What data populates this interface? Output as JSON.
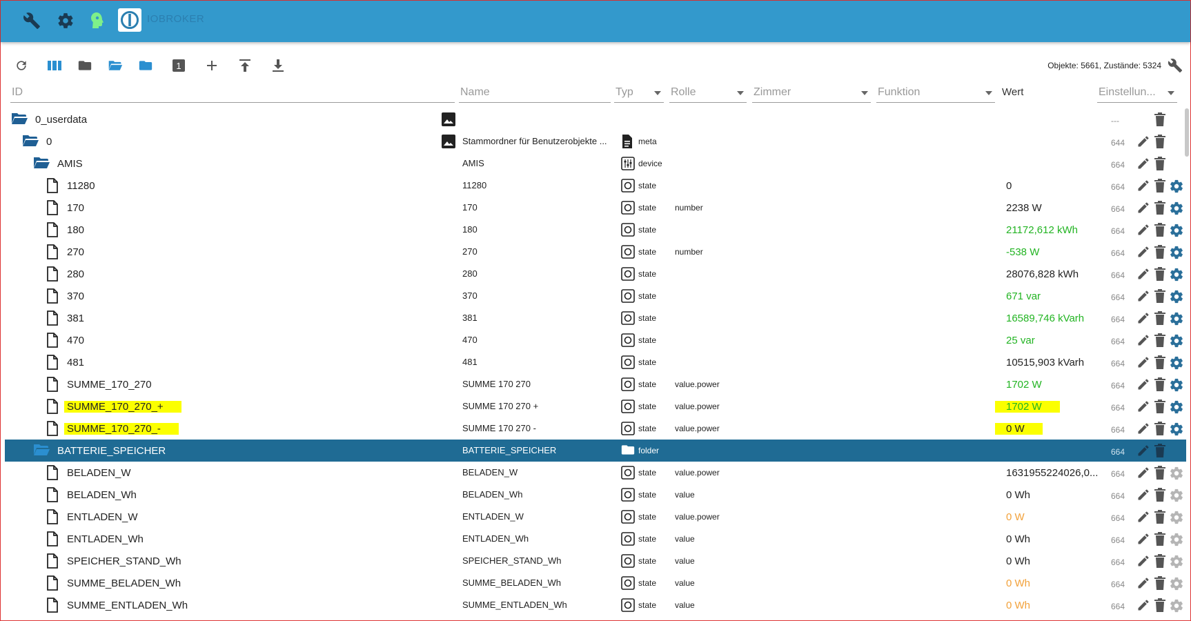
{
  "header": {
    "brand": "IOBROKER",
    "icons": [
      "wrench-icon",
      "gear-icon",
      "profile-head-icon"
    ]
  },
  "toolbar": {
    "stats": "Objekte: 5661, Zustände: 5324",
    "buttons": [
      "refresh-icon",
      "columns-icon",
      "folder-icon",
      "folder-open-icon",
      "folder-blue-icon",
      "number-one-icon",
      "plus-icon",
      "upload-icon",
      "download-icon"
    ],
    "one_label": "1"
  },
  "filters": {
    "id": "ID",
    "name": "Name",
    "type": "Typ",
    "role": "Rolle",
    "room": "Zimmer",
    "function": "Funktion",
    "value": "Wert",
    "settings": "Einstellun..."
  },
  "rows": [
    {
      "depth": 0,
      "kind": "folder",
      "id": "0_userdata",
      "img": true,
      "name": "",
      "type": "",
      "typeicon": "",
      "role": "",
      "value": "",
      "color": "dark",
      "acl": "---",
      "edit": false,
      "cfg": false,
      "hl": false,
      "selected": false
    },
    {
      "depth": 1,
      "kind": "folder",
      "id": "0",
      "img": true,
      "name": "Stammordner für Benutzerobjekte ...",
      "type": "meta",
      "typeicon": "doc",
      "role": "",
      "value": "",
      "color": "dark",
      "acl": "644",
      "edit": true,
      "cfg": false,
      "hl": false,
      "selected": false
    },
    {
      "depth": 2,
      "kind": "folder",
      "id": "AMIS",
      "img": false,
      "name": "AMIS",
      "type": "device",
      "typeicon": "device",
      "role": "",
      "value": "",
      "color": "dark",
      "acl": "664",
      "edit": true,
      "cfg": false,
      "hl": false,
      "selected": false
    },
    {
      "depth": 3,
      "kind": "file",
      "id": "11280",
      "img": false,
      "name": "11280",
      "type": "state",
      "typeicon": "state",
      "role": "",
      "value": "0",
      "color": "dark",
      "acl": "664",
      "edit": true,
      "cfg": true,
      "hl": false,
      "selected": false
    },
    {
      "depth": 3,
      "kind": "file",
      "id": "170",
      "img": false,
      "name": "170",
      "type": "state",
      "typeicon": "state",
      "role": "number",
      "value": "2238 W",
      "color": "dark",
      "acl": "664",
      "edit": true,
      "cfg": true,
      "hl": false,
      "selected": false
    },
    {
      "depth": 3,
      "kind": "file",
      "id": "180",
      "img": false,
      "name": "180",
      "type": "state",
      "typeicon": "state",
      "role": "",
      "value": "21172,612 kWh",
      "color": "green",
      "acl": "664",
      "edit": true,
      "cfg": true,
      "hl": false,
      "selected": false
    },
    {
      "depth": 3,
      "kind": "file",
      "id": "270",
      "img": false,
      "name": "270",
      "type": "state",
      "typeicon": "state",
      "role": "number",
      "value": "-538 W",
      "color": "green",
      "acl": "664",
      "edit": true,
      "cfg": true,
      "hl": false,
      "selected": false
    },
    {
      "depth": 3,
      "kind": "file",
      "id": "280",
      "img": false,
      "name": "280",
      "type": "state",
      "typeicon": "state",
      "role": "",
      "value": "28076,828 kWh",
      "color": "dark",
      "acl": "664",
      "edit": true,
      "cfg": true,
      "hl": false,
      "selected": false
    },
    {
      "depth": 3,
      "kind": "file",
      "id": "370",
      "img": false,
      "name": "370",
      "type": "state",
      "typeicon": "state",
      "role": "",
      "value": "671 var",
      "color": "green",
      "acl": "664",
      "edit": true,
      "cfg": true,
      "hl": false,
      "selected": false
    },
    {
      "depth": 3,
      "kind": "file",
      "id": "381",
      "img": false,
      "name": "381",
      "type": "state",
      "typeicon": "state",
      "role": "",
      "value": "16589,746 kVarh",
      "color": "green",
      "acl": "664",
      "edit": true,
      "cfg": true,
      "hl": false,
      "selected": false
    },
    {
      "depth": 3,
      "kind": "file",
      "id": "470",
      "img": false,
      "name": "470",
      "type": "state",
      "typeicon": "state",
      "role": "",
      "value": "25 var",
      "color": "green",
      "acl": "664",
      "edit": true,
      "cfg": true,
      "hl": false,
      "selected": false
    },
    {
      "depth": 3,
      "kind": "file",
      "id": "481",
      "img": false,
      "name": "481",
      "type": "state",
      "typeicon": "state",
      "role": "",
      "value": "10515,903 kVarh",
      "color": "dark",
      "acl": "664",
      "edit": true,
      "cfg": true,
      "hl": false,
      "selected": false
    },
    {
      "depth": 3,
      "kind": "file",
      "id": "SUMME_170_270",
      "img": false,
      "name": "SUMME 170 270",
      "type": "state",
      "typeicon": "state",
      "role": "value.power",
      "value": "1702 W",
      "color": "green",
      "acl": "664",
      "edit": true,
      "cfg": true,
      "hl": false,
      "selected": false
    },
    {
      "depth": 3,
      "kind": "file",
      "id": "SUMME_170_270_+",
      "img": false,
      "name": "SUMME 170 270 +",
      "type": "state",
      "typeicon": "state",
      "role": "value.power",
      "value": "1702 W",
      "color": "green",
      "acl": "664",
      "edit": true,
      "cfg": true,
      "hl": true,
      "selected": false
    },
    {
      "depth": 3,
      "kind": "file",
      "id": "SUMME_170_270_-",
      "img": false,
      "name": "SUMME 170 270 -",
      "type": "state",
      "typeicon": "state",
      "role": "value.power",
      "value": "0 W",
      "color": "dark",
      "acl": "664",
      "edit": true,
      "cfg": true,
      "hl": true,
      "selected": false
    },
    {
      "depth": 2,
      "kind": "folder",
      "id": "BATTERIE_SPEICHER",
      "img": false,
      "name": "BATTERIE_SPEICHER",
      "type": "folder",
      "typeicon": "folder",
      "role": "",
      "value": "",
      "color": "dark",
      "acl": "664",
      "edit": true,
      "cfg": false,
      "hl": false,
      "selected": true
    },
    {
      "depth": 3,
      "kind": "file",
      "id": "BELADEN_W",
      "img": false,
      "name": "BELADEN_W",
      "type": "state",
      "typeicon": "state",
      "role": "value.power",
      "value": "1631955224026,0...",
      "color": "dark",
      "acl": "664",
      "edit": true,
      "cfg": true,
      "cfgGrey": true,
      "hl": false,
      "selected": false
    },
    {
      "depth": 3,
      "kind": "file",
      "id": "BELADEN_Wh",
      "img": false,
      "name": "BELADEN_Wh",
      "type": "state",
      "typeicon": "state",
      "role": "value",
      "value": "0 Wh",
      "color": "dark",
      "acl": "664",
      "edit": true,
      "cfg": true,
      "cfgGrey": true,
      "hl": false,
      "selected": false
    },
    {
      "depth": 3,
      "kind": "file",
      "id": "ENTLADEN_W",
      "img": false,
      "name": "ENTLADEN_W",
      "type": "state",
      "typeicon": "state",
      "role": "value.power",
      "value": "0 W",
      "color": "orange",
      "acl": "664",
      "edit": true,
      "cfg": true,
      "cfgGrey": true,
      "hl": false,
      "selected": false
    },
    {
      "depth": 3,
      "kind": "file",
      "id": "ENTLADEN_Wh",
      "img": false,
      "name": "ENTLADEN_Wh",
      "type": "state",
      "typeicon": "state",
      "role": "value",
      "value": "0 Wh",
      "color": "dark",
      "acl": "664",
      "edit": true,
      "cfg": true,
      "cfgGrey": true,
      "hl": false,
      "selected": false
    },
    {
      "depth": 3,
      "kind": "file",
      "id": "SPEICHER_STAND_Wh",
      "img": false,
      "name": "SPEICHER_STAND_Wh",
      "type": "state",
      "typeicon": "state",
      "role": "value",
      "value": "0 Wh",
      "color": "dark",
      "acl": "664",
      "edit": true,
      "cfg": true,
      "cfgGrey": true,
      "hl": false,
      "selected": false
    },
    {
      "depth": 3,
      "kind": "file",
      "id": "SUMME_BELADEN_Wh",
      "img": false,
      "name": "SUMME_BELADEN_Wh",
      "type": "state",
      "typeicon": "state",
      "role": "value",
      "value": "0 Wh",
      "color": "orange",
      "acl": "664",
      "edit": true,
      "cfg": true,
      "cfgGrey": true,
      "hl": false,
      "selected": false
    },
    {
      "depth": 3,
      "kind": "file",
      "id": "SUMME_ENTLADEN_Wh",
      "img": false,
      "name": "SUMME_ENTLADEN_Wh",
      "type": "state",
      "typeicon": "state",
      "role": "value",
      "value": "0 Wh",
      "color": "orange",
      "acl": "664",
      "edit": true,
      "cfg": true,
      "cfgGrey": true,
      "hl": false,
      "selected": false
    }
  ],
  "colors": {
    "header": "#3399cc",
    "selected": "#1f6b94",
    "green": "#22b422",
    "orange": "#f2a13a",
    "highlight": "#fbff00"
  }
}
